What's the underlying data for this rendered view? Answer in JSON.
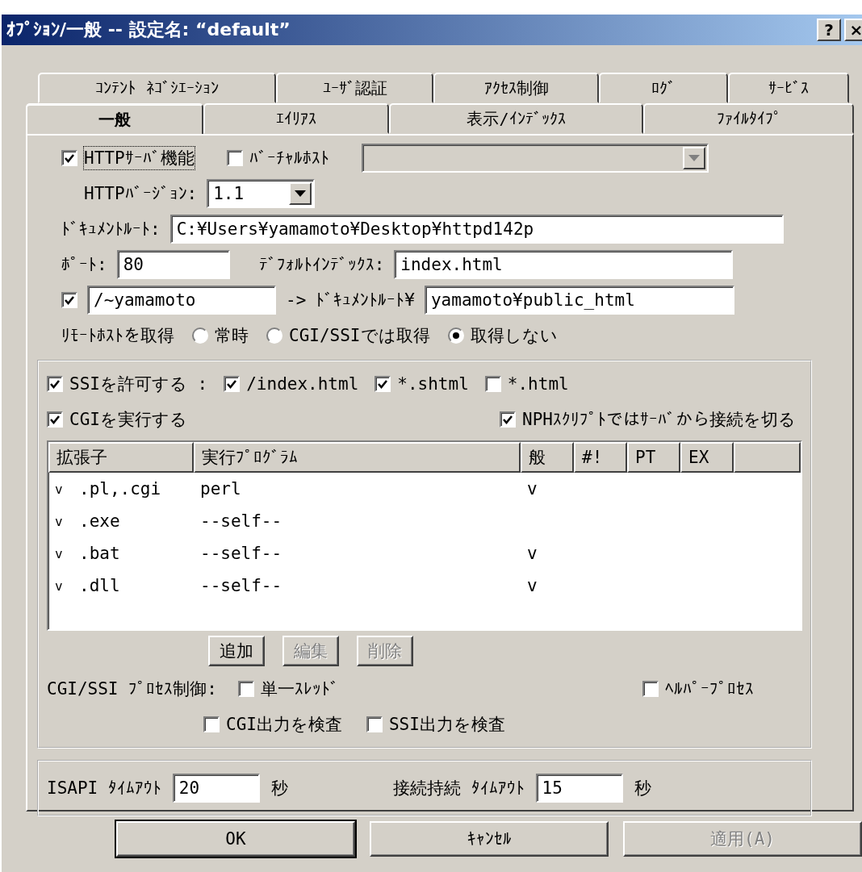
{
  "window": {
    "title": "ｵﾌﾟｼｮﾝ/一般 -- 設定名: “default”",
    "help": "?",
    "close": "×"
  },
  "tab_rows": [
    {
      "tabs": [
        {
          "label": "ｺﾝﾃﾝﾄ ﾈｺﾞｼｴｰｼｮﾝ",
          "selected": false
        },
        {
          "label": "ﾕｰｻﾞ認証",
          "selected": false
        },
        {
          "label": "ｱｸｾｽ制御",
          "selected": false
        },
        {
          "label": "ﾛｸﾞ",
          "selected": false
        },
        {
          "label": "ｻｰﾋﾞｽ",
          "selected": false
        }
      ]
    },
    {
      "tabs": [
        {
          "label": "一般",
          "selected": true
        },
        {
          "label": "ｴｲﾘｱｽ",
          "selected": false
        },
        {
          "label": "表示/ｲﾝﾃﾞｯｸｽ",
          "selected": false
        },
        {
          "label": "ﾌｧｲﾙﾀｲﾌﾟ",
          "selected": false
        }
      ]
    }
  ],
  "general": {
    "http_server": {
      "label": "HTTPｻｰﾊﾞ機能",
      "checked": true,
      "focused": true
    },
    "virtual_host": {
      "label": "ﾊﾞｰﾁｬﾙﾎｽﾄ",
      "checked": false,
      "select_disabled": true
    },
    "http_version": {
      "label": "HTTPﾊﾞｰｼﾞｮﾝ:",
      "value": "1.1"
    },
    "document_root": {
      "label": "ﾄﾞｷｭﾒﾝﾄﾙｰﾄ:",
      "value": "C:¥Users¥yamamoto¥Desktop¥httpd142p"
    },
    "port": {
      "label": "ﾎﾟｰﾄ:",
      "value": "80"
    },
    "default_index": {
      "label": "ﾃﾞﾌｫﾙﾄｲﾝﾃﾞｯｸｽ:",
      "value": "index.html"
    },
    "user_dir": {
      "checked": true,
      "value": "/~yamamoto",
      "arrow": "->",
      "label": "ﾄﾞｷｭﾒﾝﾄﾙｰﾄ¥",
      "target": "yamamoto¥public_html"
    },
    "remote_host": {
      "label": "ﾘﾓｰﾄﾎｽﾄを取得",
      "options": [
        {
          "label": "常時",
          "selected": false
        },
        {
          "label": "CGI/SSIでは取得",
          "selected": false
        },
        {
          "label": "取得しない",
          "selected": true
        }
      ]
    }
  },
  "scripts": {
    "ssi": {
      "label": "SSIを許可する :",
      "checked": true
    },
    "ssi_types": [
      {
        "label": "/index.html",
        "checked": true
      },
      {
        "label": "*.shtml",
        "checked": true
      },
      {
        "label": "*.html",
        "checked": false
      }
    ],
    "cgi": {
      "label": "CGIを実行する",
      "checked": true
    },
    "nph": {
      "label": "NPHｽｸﾘﾌﾟﾄではｻｰﾊﾞから接続を切る",
      "checked": true
    },
    "table": {
      "columns": [
        "拡張子",
        "実行ﾌﾟﾛｸﾞﾗﾑ",
        "般",
        "#!",
        "PT",
        "EX"
      ],
      "rows": [
        {
          "mark": "v",
          "extension": ".pl,.cgi",
          "program": "perl",
          "general": "v"
        },
        {
          "mark": "v",
          "extension": ".exe",
          "program": "--self--"
        },
        {
          "mark": "v",
          "extension": ".bat",
          "program": "--self--",
          "general": "v"
        },
        {
          "mark": "v",
          "extension": ".dll",
          "program": "--self--",
          "general": "v"
        }
      ]
    },
    "buttons": [
      {
        "label": "追加",
        "disabled": false
      },
      {
        "label": "編集",
        "disabled": true
      },
      {
        "label": "削除",
        "disabled": true
      }
    ],
    "process_label": "CGI/SSI ﾌﾟﾛｾｽ制御:",
    "process_options": [
      {
        "label": "単一ｽﾚｯﾄﾞ",
        "checked": false
      },
      {
        "label": "ﾍﾙﾊﾟｰﾌﾟﾛｾｽ",
        "checked": false
      },
      {
        "label": "CGI出力を検査",
        "checked": false
      },
      {
        "label": "SSI出力を検査",
        "checked": false
      }
    ]
  },
  "timeouts": [
    {
      "label": "ISAPI ﾀｲﾑｱｳﾄ",
      "value": "20",
      "unit": "秒"
    },
    {
      "label": "接続持続 ﾀｲﾑｱｳﾄ",
      "value": "15",
      "unit": "秒"
    }
  ],
  "buttons": [
    {
      "label": "OK",
      "default": true,
      "disabled": false
    },
    {
      "label": "ｷｬﾝｾﾙ",
      "default": false,
      "disabled": false
    },
    {
      "label": "適用(A)",
      "default": false,
      "disabled": true
    }
  ]
}
